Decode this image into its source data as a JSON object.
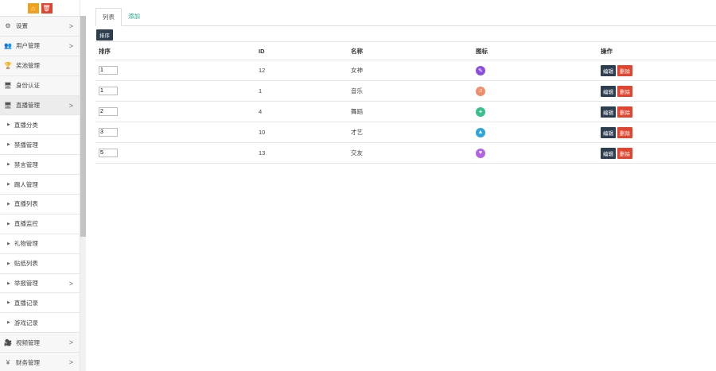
{
  "sidebar": {
    "top_buttons": [
      {
        "icon": "home-icon",
        "glyph": "⌂",
        "color": "#f0a21c"
      },
      {
        "icon": "trash-icon",
        "glyph": "🗑",
        "color": "#e1452f"
      }
    ],
    "items": [
      {
        "label": "设置",
        "icon": "gear-icon",
        "glyph": "⚙",
        "chevron": true
      },
      {
        "label": "用户管理",
        "icon": "users-icon",
        "glyph": "👥",
        "chevron": true
      },
      {
        "label": "奖池管理",
        "icon": "trophy-icon",
        "glyph": "🏆",
        "chevron": false
      },
      {
        "label": "身份认证",
        "icon": "monitor-icon",
        "glyph": "🖥",
        "chevron": false
      },
      {
        "label": "直播管理",
        "icon": "monitor-icon",
        "glyph": "🖥",
        "chevron": true,
        "active": true
      }
    ],
    "sub_items": [
      {
        "label": "直播分类"
      },
      {
        "label": "禁播管理"
      },
      {
        "label": "禁言管理"
      },
      {
        "label": "踢人管理"
      },
      {
        "label": "直播列表"
      },
      {
        "label": "直播监控"
      },
      {
        "label": "礼物管理"
      },
      {
        "label": "贴纸列表"
      },
      {
        "label": "举报管理",
        "chevron": true
      },
      {
        "label": "直播记录"
      },
      {
        "label": "游戏记录"
      }
    ],
    "bottom_items": [
      {
        "label": "视频管理",
        "icon": "video-camera-icon",
        "glyph": "🎥",
        "chevron": true
      },
      {
        "label": "财务管理",
        "icon": "yen-icon",
        "glyph": "¥",
        "chevron": true
      }
    ]
  },
  "tabs": [
    {
      "label": "列表",
      "active": true
    },
    {
      "label": "添加",
      "active": false
    }
  ],
  "sort_button": "排序",
  "table": {
    "headers": [
      "排序",
      "ID",
      "名称",
      "图标",
      "操作"
    ],
    "rows": [
      {
        "sort": "1",
        "id": "12",
        "name": "女神",
        "icon_color": "#8a4fe0"
      },
      {
        "sort": "1",
        "id": "1",
        "name": "音乐",
        "icon_color": "#f08d6a"
      },
      {
        "sort": "2",
        "id": "4",
        "name": "舞蹈",
        "icon_color": "#37c18d"
      },
      {
        "sort": "3",
        "id": "10",
        "name": "才艺",
        "icon_color": "#2ba6dc"
      },
      {
        "sort": "5",
        "id": "13",
        "name": "交友",
        "icon_color": "#b563e6"
      }
    ],
    "edit_label": "编辑",
    "delete_label": "删除"
  }
}
